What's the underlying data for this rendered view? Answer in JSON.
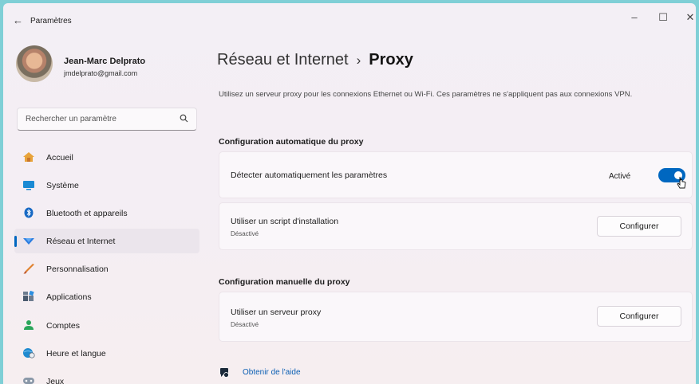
{
  "window": {
    "title": "Paramètres",
    "controls": {
      "minimize": "–",
      "maximize": "☐",
      "close": "✕"
    }
  },
  "profile": {
    "name": "Jean-Marc Delprato",
    "email": "jmdelprato@gmail.com"
  },
  "search": {
    "placeholder": "Rechercher un paramètre",
    "icon": "search-icon"
  },
  "sidebar": {
    "items": [
      {
        "label": "Accueil",
        "icon": "home-icon",
        "selected": false
      },
      {
        "label": "Système",
        "icon": "system-icon",
        "selected": false
      },
      {
        "label": "Bluetooth et appareils",
        "icon": "bluetooth-icon",
        "selected": false
      },
      {
        "label": "Réseau et Internet",
        "icon": "network-icon",
        "selected": true
      },
      {
        "label": "Personnalisation",
        "icon": "brush-icon",
        "selected": false
      },
      {
        "label": "Applications",
        "icon": "apps-icon",
        "selected": false
      },
      {
        "label": "Comptes",
        "icon": "person-icon",
        "selected": false
      },
      {
        "label": "Heure et langue",
        "icon": "globe-clock-icon",
        "selected": false
      },
      {
        "label": "Jeux",
        "icon": "gamepad-icon",
        "selected": false
      }
    ]
  },
  "main": {
    "breadcrumb": {
      "parent": "Réseau et Internet",
      "separator": "›",
      "current": "Proxy"
    },
    "description": "Utilisez un serveur proxy pour les connexions Ethernet ou Wi-Fi. Ces paramètres ne s'appliquent pas aux connexions VPN.",
    "auto_section": {
      "title": "Configuration automatique du proxy",
      "detect": {
        "label": "Détecter automatiquement les paramètres",
        "state": "Activé",
        "on": true
      },
      "script": {
        "label": "Utiliser un script d'installation",
        "status": "Désactivé",
        "button": "Configurer"
      }
    },
    "manual_section": {
      "title": "Configuration manuelle du proxy",
      "server": {
        "label": "Utiliser un serveur proxy",
        "status": "Désactivé",
        "button": "Configurer"
      }
    },
    "help": {
      "label": "Obtenir de l'aide",
      "icon": "help-icon"
    }
  },
  "colors": {
    "accent": "#0067c0",
    "link": "#0b5fb3",
    "frame": "#7fcfd6"
  }
}
